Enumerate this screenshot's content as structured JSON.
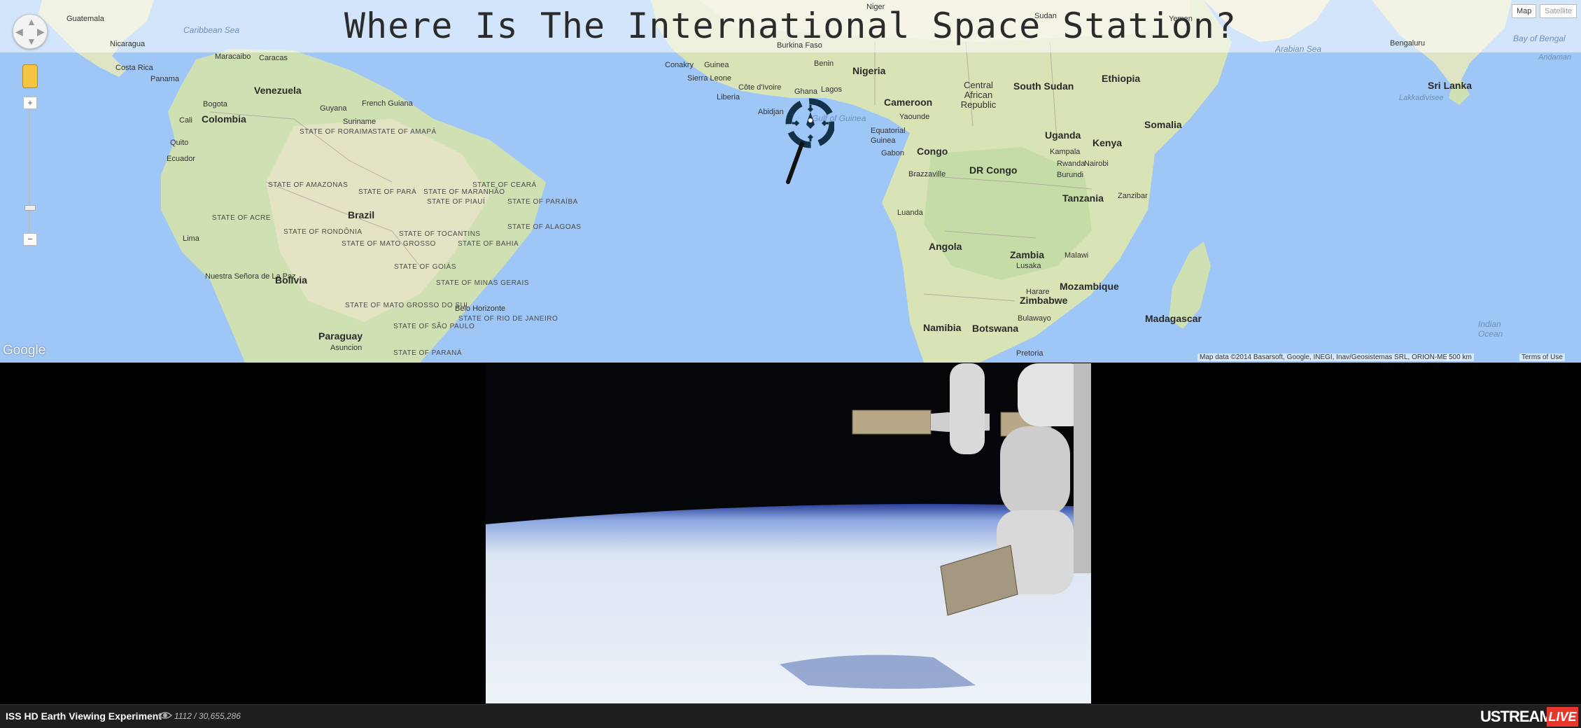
{
  "page": {
    "title": "Where Is The International Space Station?"
  },
  "map": {
    "type_buttons": [
      "Map",
      "Satellite"
    ],
    "zoom_in": "+",
    "zoom_out": "−",
    "logo": "Google",
    "attribution": "Map data ©2014 Basarsoft, Google, INEGI, Inav/Geosistemas SRL, ORION-ME",
    "scale": "500 km",
    "terms": "Terms of Use",
    "labels": {
      "guatemala": "Guatemala",
      "caribbean": "Caribbean Sea",
      "nicaragua": "Nicaragua",
      "costa_rica": "Costa Rica",
      "panama": "Panama",
      "maracaibo": "Maracaibo",
      "caracas": "Caracas",
      "venezuela": "Venezuela",
      "bogota": "Bogota",
      "guyana": "Guyana",
      "french_guiana": "French Guiana",
      "suriname": "Suriname",
      "cali": "Cali",
      "colombia": "Colombia",
      "quito": "Quito",
      "ecuador": "Ecuador",
      "roraima": "STATE OF RORAIMA",
      "amapa": "STATE OF AMAPÁ",
      "amazonas": "STATE OF AMAZONAS",
      "para": "STATE OF PARÁ",
      "maranhao": "STATE OF MARANHÃO",
      "piaui": "STATE OF PIAUÍ",
      "ceara": "STATE OF CEARÁ",
      "paraiba": "STATE OF PARAÍBA",
      "alagoas": "STATE OF ALAGOAS",
      "acre": "STATE OF ACRE",
      "brazil": "Brazil",
      "rondonia": "STATE OF RONDÔNIA",
      "mato_grosso": "STATE OF MATO GROSSO",
      "tocantins": "STATE OF TOCANTINS",
      "bahia": "STATE OF BAHIA",
      "lima": "Lima",
      "goias": "STATE OF GOIÁS",
      "minas": "STATE OF MINAS GERAIS",
      "nuestra": "Nuestra Señora de La Paz",
      "bolivia": "Bolivia",
      "belo": "Belo Horizonte",
      "ms": "STATE OF MATO GROSSO DO SUL",
      "rio": "STATE OF RIO DE JANEIRO",
      "sp": "STATE OF SÃO PAULO",
      "paraguay": "Paraguay",
      "asuncion": "Asuncion",
      "parana": "STATE OF PARANÁ",
      "niger": "Niger",
      "conakry": "Conakry",
      "guinea": "Guinea",
      "burkina": "Burkina Faso",
      "benin": "Benin",
      "sierra": "Sierra Leone",
      "cote": "Côte d'Ivoire",
      "ghana": "Ghana",
      "lagos": "Lagos",
      "liberia": "Liberia",
      "abidjan": "Abidjan",
      "nigeria": "Nigeria",
      "gulf": "Gulf of Guinea",
      "sudan": "Sudan",
      "yemen": "Yemen",
      "cameroon": "Cameroon",
      "car": "Central African Republic",
      "south_sudan": "South Sudan",
      "ethiopia": "Ethiopia",
      "yaounde": "Yaounde",
      "eq_guinea": "Equatorial Guinea",
      "gabon": "Gabon",
      "congo": "Congo",
      "uganda": "Uganda",
      "kenya": "Kenya",
      "somalia": "Somalia",
      "kampala": "Kampala",
      "nairobi": "Nairobi",
      "rwanda": "Rwanda",
      "burundi": "Burundi",
      "brazzaville": "Brazzaville",
      "dr_congo": "DR Congo",
      "tanzania": "Tanzania",
      "zanzibar": "Zanzibar",
      "luanda": "Luanda",
      "angola": "Angola",
      "zambia": "Zambia",
      "malawi": "Malawi",
      "lusaka": "Lusaka",
      "harare": "Harare",
      "zimbabwe": "Zimbabwe",
      "mozambique": "Mozambique",
      "bulawayo": "Bulawayo",
      "namibia": "Namibia",
      "botswana": "Botswana",
      "madagascar": "Madagascar",
      "pretoria": "Pretoria",
      "indian_ocean": "Indian Ocean",
      "arabian": "Arabian Sea",
      "bengaluru": "Bengaluru",
      "bay": "Bay of Bengal",
      "sri_lanka": "Sri Lanka",
      "lakkadivisee": "Lakkadivisee",
      "andaman": "Andaman"
    }
  },
  "stream": {
    "title": "ISS HD Earth Viewing Experiment",
    "views": "1112 / 30,655,286",
    "brand": "USTREAM",
    "live": "LIVE"
  },
  "colors": {
    "map_water": "#9ec6f7",
    "map_land": "#e7e1c9",
    "map_green": "#bcd8a1",
    "marker": "#13324a",
    "live_badge": "#e8362d"
  },
  "icons": [
    "pan-control-icon",
    "pegman-icon",
    "iss-locator-icon",
    "eye-icon"
  ]
}
